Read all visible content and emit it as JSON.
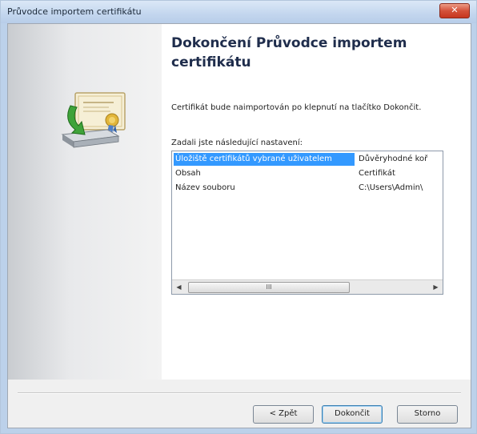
{
  "window": {
    "title": "Průvodce importem certifikátu",
    "close_label": "✕"
  },
  "main": {
    "heading": "Dokončení Průvodce importem certifikátu",
    "info": "Certifikát bude naimportován po klepnutí na tlačítko Dokončit.",
    "settings_label": "Zadali jste následující nastavení:",
    "rows": [
      {
        "name": "Úložiště certifikátů vybrané uživatelem",
        "value": "Důvěryhodné koř"
      },
      {
        "name": "Obsah",
        "value": "Certifikát"
      },
      {
        "name": "Název souboru",
        "value": "C:\\Users\\Admin\\"
      }
    ],
    "scroll_thumb_grip": "III"
  },
  "buttons": {
    "back": "< Zpět",
    "finish": "Dokončit",
    "cancel": "Storno"
  },
  "icons": {
    "wizard": "certificate-import-icon",
    "close": "close-icon"
  },
  "colors": {
    "selection": "#3399ff",
    "close_button": "#d4513a",
    "heading": "#1f2d4c"
  }
}
